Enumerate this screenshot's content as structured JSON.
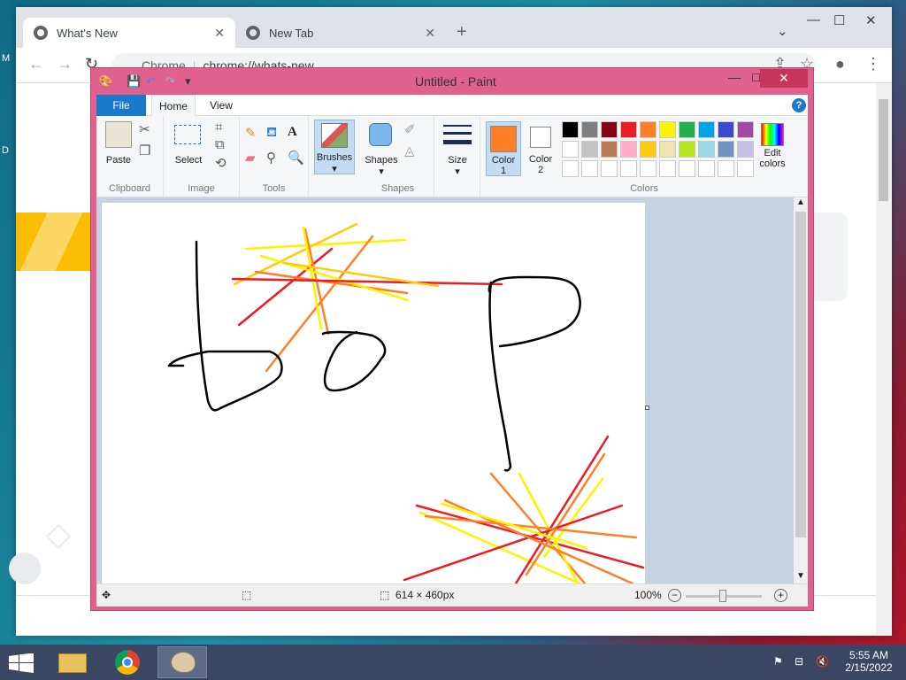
{
  "desktop": {
    "side_label_1": "M",
    "side_label_2": "D"
  },
  "chrome": {
    "tabs": [
      {
        "label": "What's New",
        "close": "✕"
      },
      {
        "label": "New Tab",
        "close": "✕"
      }
    ],
    "new_tab": "+",
    "window_controls": {
      "menu": "⌄",
      "minimize": "—",
      "maximize": "☐",
      "close": "✕"
    },
    "nav": {
      "back": "←",
      "forward": "→",
      "reload": "↻"
    },
    "omnibox": {
      "site_label": "Chrome",
      "url": "chrome://whats-new"
    },
    "toolbar_icons": {
      "share": "⇪",
      "star": "☆",
      "account": "●",
      "menu": "⋮"
    }
  },
  "paint": {
    "title": "Untitled - Paint",
    "window_controls": {
      "minimize": "—",
      "maximize": "☐",
      "close": "✕"
    },
    "ribbon_tabs": {
      "file": "File",
      "home": "Home",
      "view": "View"
    },
    "help": "?",
    "groups": {
      "clipboard": {
        "label": "Clipboard",
        "paste": "Paste"
      },
      "image": {
        "label": "Image",
        "select": "Select"
      },
      "tools": {
        "label": "Tools"
      },
      "brushes": {
        "label": "Brushes"
      },
      "shapes": {
        "label": "Shapes",
        "shapes_button": "Shapes"
      },
      "size": {
        "label": "Size"
      },
      "colors": {
        "label": "Colors",
        "color1": "Color\n1",
        "color1_a": "Color",
        "color1_b": "1",
        "color2_a": "Color",
        "color2_b": "2",
        "edit_a": "Edit",
        "edit_b": "colors",
        "color1_value": "#ff7f27",
        "color2_value": "#ffffff",
        "palette_row1": [
          "#000000",
          "#7f7f7f",
          "#880015",
          "#ed1c24",
          "#ff7f27",
          "#fff200",
          "#22b14c",
          "#00a2e8",
          "#3f48cc",
          "#a349a4"
        ],
        "palette_row2": [
          "#ffffff",
          "#c3c3c3",
          "#b97a57",
          "#ffaec9",
          "#ffc90e",
          "#efe4b0",
          "#b5e61d",
          "#99d9ea",
          "#7092be",
          "#c8bfe7"
        ],
        "palette_row3": [
          "#ffffff",
          "#ffffff",
          "#ffffff",
          "#ffffff",
          "#ffffff",
          "#ffffff",
          "#ffffff",
          "#ffffff",
          "#ffffff",
          "#ffffff"
        ]
      }
    },
    "status": {
      "canvas_size": "614 × 460px",
      "zoom": "100%",
      "zoom_out": "−",
      "zoom_in": "+"
    }
  },
  "taskbar": {
    "time": "5:55 AM",
    "date": "2/15/2022"
  }
}
